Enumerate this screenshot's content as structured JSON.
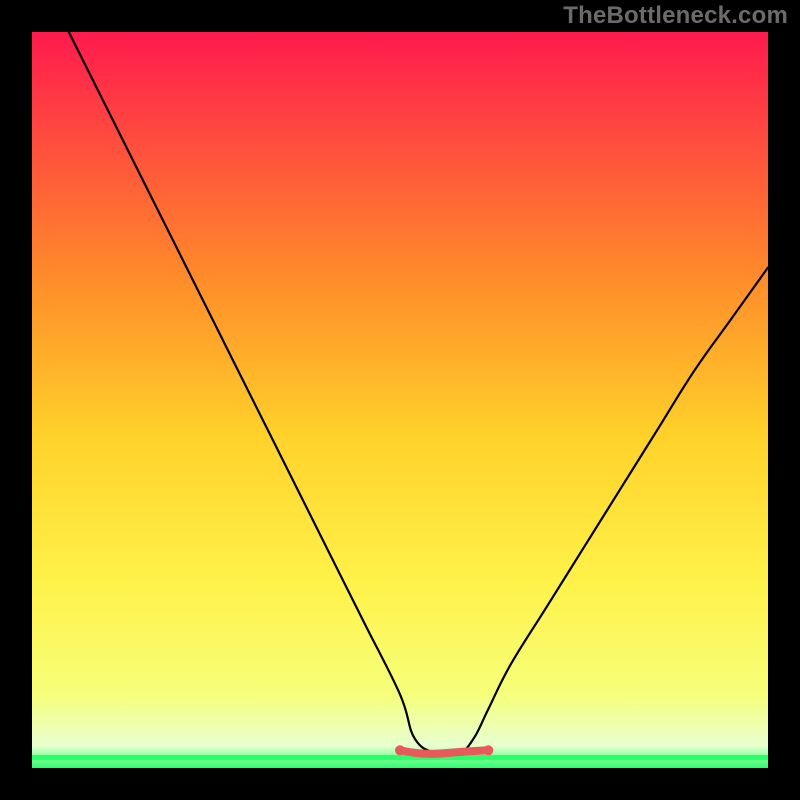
{
  "watermark": "TheBottleneck.com",
  "colors": {
    "frame": "#000000",
    "grad_top": "#ff1a4e",
    "grad_mid_upper": "#ff6a2e",
    "grad_mid": "#ffd22a",
    "grad_mid_lower": "#fff24a",
    "grad_low": "#f6ff7a",
    "grad_green": "#2aff6a",
    "curve_stroke": "#000000",
    "red_band": "#e85a5a",
    "red_band_text_bg": "#e85a5a",
    "red_band_text": "#b64040"
  },
  "chart_data": {
    "type": "line",
    "title": "",
    "xlabel": "",
    "ylabel": "",
    "xlim": [
      0,
      100
    ],
    "ylim": [
      0,
      100
    ],
    "series": [
      {
        "name": "bottleneck-curve",
        "x": [
          5,
          10,
          15,
          20,
          25,
          30,
          35,
          40,
          45,
          50,
          52,
          55,
          58,
          60,
          62,
          65,
          70,
          75,
          80,
          85,
          90,
          95,
          100
        ],
        "values": [
          100,
          90,
          80,
          70,
          60,
          50,
          40,
          30,
          20,
          10,
          4,
          2,
          2,
          4,
          8,
          14,
          22,
          30,
          38,
          46,
          54,
          61,
          68
        ]
      }
    ],
    "annotations": [
      {
        "name": "flat-minimum-band",
        "x_start": 50,
        "x_end": 62,
        "y": 2
      }
    ],
    "green_line_y": 1.5
  }
}
